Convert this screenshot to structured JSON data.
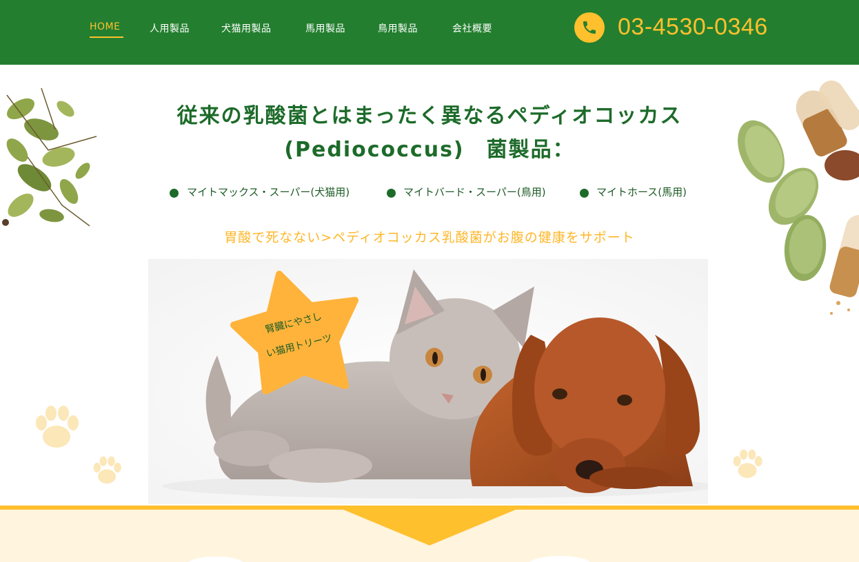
{
  "nav": {
    "items": [
      {
        "label": "HOME",
        "active": true
      },
      {
        "label": "人用製品"
      },
      {
        "label": "犬猫用製品"
      },
      {
        "label": "馬用製品"
      },
      {
        "label": "鳥用製品"
      },
      {
        "label": "会社概要"
      }
    ],
    "phone": "03-4530-0346"
  },
  "hero": {
    "title_line1": "従来の乳酸菌とはまったく異なるペディオコッカス",
    "title_line2": "(Pediococcus)　菌製品：",
    "products": [
      "マイトマックス・スーパー(犬猫用)",
      "マイトバード・スーパー(鳥用)",
      "マイトホース(馬用)"
    ],
    "subtitle": "胃酸で死なない>ペディオコッカス乳酸菌がお腹の健康をサポート",
    "badge": {
      "line1": "腎臓にやさし",
      "line2": "い猫用トリーツ"
    }
  },
  "colors": {
    "header_green": "#237f2f",
    "accent_yellow": "#ffc02e",
    "title_green": "#1d6b2a",
    "subtitle_orange": "#ffb626",
    "band_cream": "#fff4dd"
  },
  "icons": {
    "phone": "phone-icon",
    "paw": "paw-print-icon"
  }
}
